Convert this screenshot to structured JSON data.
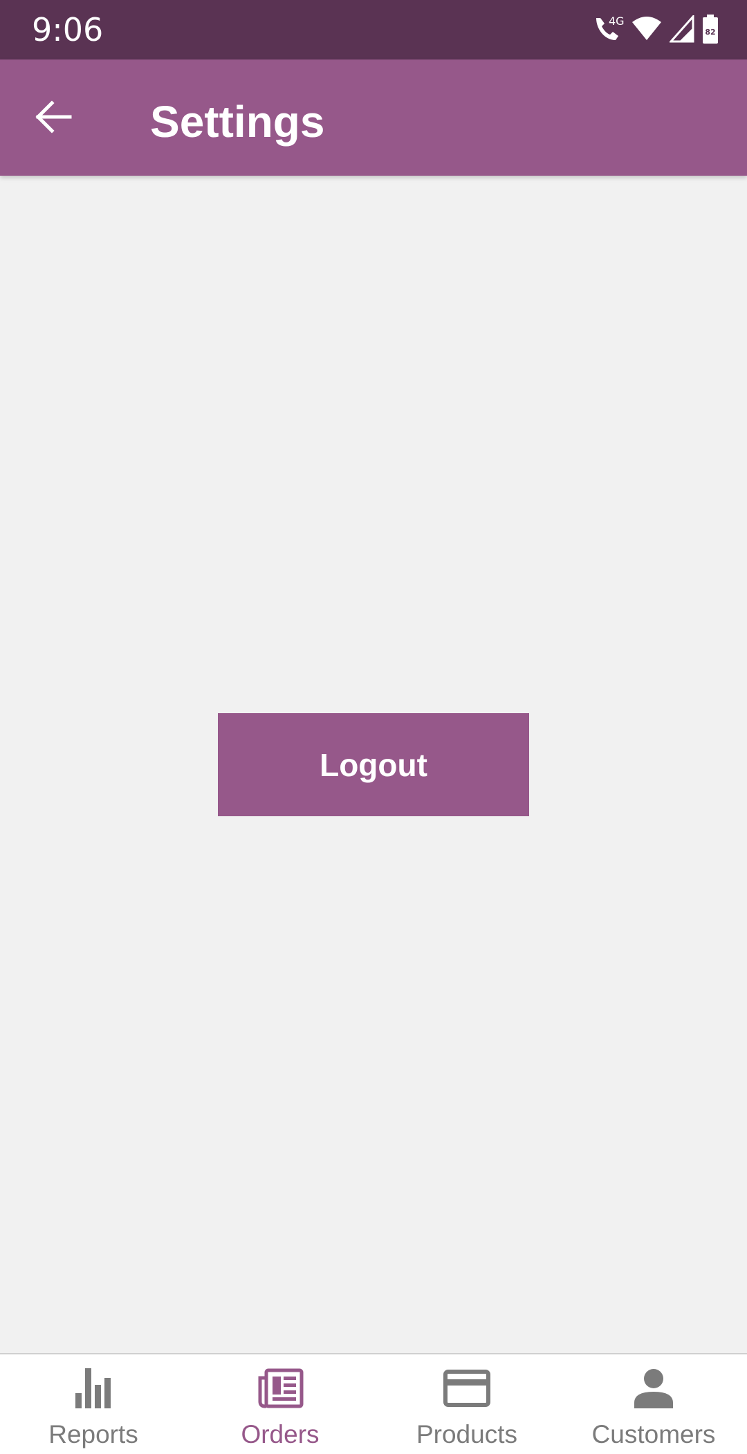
{
  "status_bar": {
    "time": "9:06",
    "network_label": "4G",
    "battery_level": "82"
  },
  "app_bar": {
    "title": "Settings",
    "back_icon": "arrow-back-icon"
  },
  "main": {
    "logout_label": "Logout"
  },
  "bottom_nav": {
    "active_index": 1,
    "items": [
      {
        "label": "Reports",
        "icon": "bar-chart-icon"
      },
      {
        "label": "Orders",
        "icon": "orders-icon"
      },
      {
        "label": "Products",
        "icon": "card-icon"
      },
      {
        "label": "Customers",
        "icon": "person-icon"
      }
    ]
  },
  "colors": {
    "status_bar": "#5a3353",
    "primary": "#96588a",
    "background": "#f1f1f1",
    "nav_inactive": "#7b7b7b"
  }
}
